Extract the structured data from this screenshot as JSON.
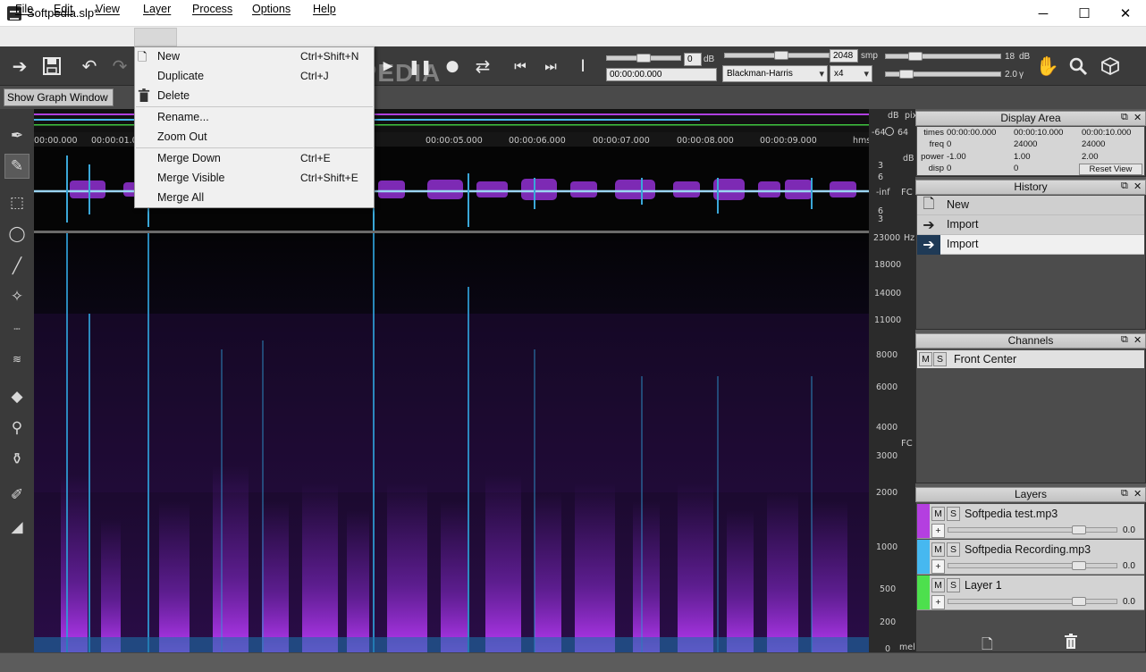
{
  "window": {
    "title": "Softpedia.slp*",
    "minimize": "─",
    "maximize": "☐",
    "close": "✕"
  },
  "menubar": {
    "items": [
      "File",
      "Edit",
      "View",
      "Layer",
      "Process",
      "Options",
      "Help"
    ]
  },
  "layer_menu": {
    "items": [
      {
        "label": "New",
        "shortcut": "Ctrl+Shift+N",
        "icon": "new-layer-icon"
      },
      {
        "label": "Duplicate",
        "shortcut": "Ctrl+J",
        "icon": ""
      },
      {
        "label": "Delete",
        "shortcut": "",
        "icon": "trash-icon"
      },
      {
        "label": "Rename...",
        "shortcut": "",
        "icon": ""
      },
      {
        "label": "Zoom Out",
        "shortcut": "",
        "icon": ""
      },
      {
        "label": "Merge Down",
        "shortcut": "Ctrl+E",
        "icon": ""
      },
      {
        "label": "Merge Visible",
        "shortcut": "Ctrl+Shift+E",
        "icon": ""
      },
      {
        "label": "Merge All",
        "shortcut": "",
        "icon": ""
      }
    ]
  },
  "toolbar": {
    "volume_value": "0",
    "volume_unit": "dB",
    "time_value": "00:00:00.000",
    "fft_size": "2048",
    "fft_unit": "smp",
    "window_function": "Blackman-Harris",
    "overlap": "x4",
    "range_value": "18",
    "range_unit": "dB",
    "gamma_value": "2.0",
    "gamma_unit": "γ"
  },
  "subbar": {
    "show_graph": "Show Graph Window"
  },
  "watermark": "SOFTPEDIA",
  "timeline": {
    "labels": [
      "00:00.000",
      "00:00:01.000",
      "00:00:05.000",
      "00:00:06.000",
      "00:00:07.000",
      "00:00:08.000",
      "00:00:09.000"
    ],
    "unit": "hms"
  },
  "wave_axis": {
    "db": "dB",
    "pix": "pix",
    "top_neg": "-64",
    "top_pos": "64",
    "ticks": [
      "3",
      "6",
      "-inf",
      "6",
      "3"
    ],
    "fc": "FC"
  },
  "freq_axis": {
    "unit": "Hz",
    "ticks": [
      "23000",
      "18000",
      "14000",
      "11000",
      "8000",
      "6000",
      "4000",
      "3000",
      "2000",
      "1000",
      "500",
      "200",
      "0"
    ],
    "fc": "FC",
    "bottom": "mel"
  },
  "display_area": {
    "title": "Display Area",
    "row_labels": [
      "times",
      "freq",
      "power",
      "disp"
    ],
    "rows": [
      [
        "00:00:00.000",
        "00:00:10.000",
        "00:00:10.000"
      ],
      [
        "0",
        "24000",
        "24000"
      ],
      [
        "-1.00",
        "1.00",
        "2.00"
      ],
      [
        "0",
        "0",
        ""
      ]
    ],
    "reset_view": "Reset View"
  },
  "history": {
    "title": "History",
    "items": [
      "New",
      "Import",
      "Import"
    ]
  },
  "channels": {
    "title": "Channels",
    "items": [
      {
        "m": "M",
        "s": "S",
        "name": "Front Center"
      }
    ]
  },
  "layers": {
    "title": "Layers",
    "items": [
      {
        "name": "Softpedia test.mp3",
        "value": "0.0",
        "color": "#b43fe0"
      },
      {
        "name": "Softpedia Recording.mp3",
        "value": "0.0",
        "color": "#46b8f0"
      },
      {
        "name": "Layer 1",
        "value": "0.0",
        "color": "#4de04d"
      }
    ],
    "m": "M",
    "s": "S",
    "plus": "+"
  }
}
